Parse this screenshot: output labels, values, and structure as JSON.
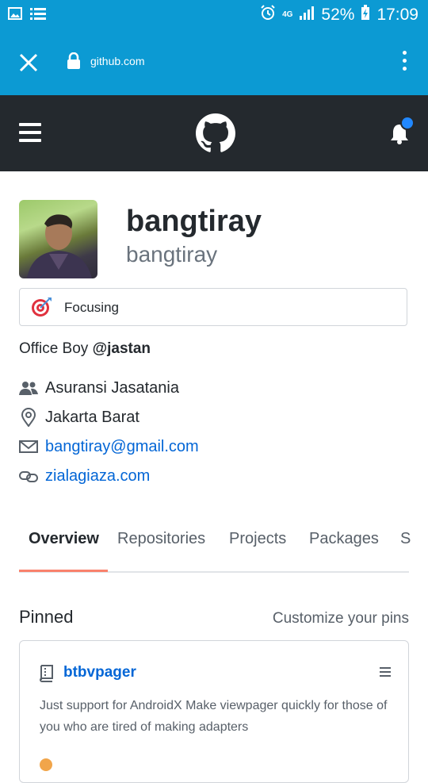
{
  "status_bar": {
    "battery": "52%",
    "time": "17:09",
    "network": "4G"
  },
  "browser": {
    "url": "github.com"
  },
  "profile": {
    "name": "bangtiray",
    "login": "bangtiray",
    "status": "Focusing",
    "bio_text": "Office Boy ",
    "bio_mention": "@jastan",
    "company": "Asuransi Jasatania",
    "location": "Jakarta Barat",
    "email": "bangtiray@gmail.com",
    "website": "zialagiaza.com"
  },
  "tabs": {
    "overview": "Overview",
    "repositories": "Repositories",
    "projects": "Projects",
    "packages": "Packages",
    "stars": "S"
  },
  "pinned": {
    "title": "Pinned",
    "customize": "Customize your pins",
    "repos": [
      {
        "name": "btbvpager",
        "description": "Just support for AndroidX Make viewpager quickly for those of you who are tired of making adapters"
      }
    ]
  },
  "colors": {
    "status_bar": "#0c9ad3",
    "header": "#24292e",
    "link": "#0366d6",
    "active_tab_underline": "#f9826c",
    "notification_dot": "#2188ff"
  }
}
